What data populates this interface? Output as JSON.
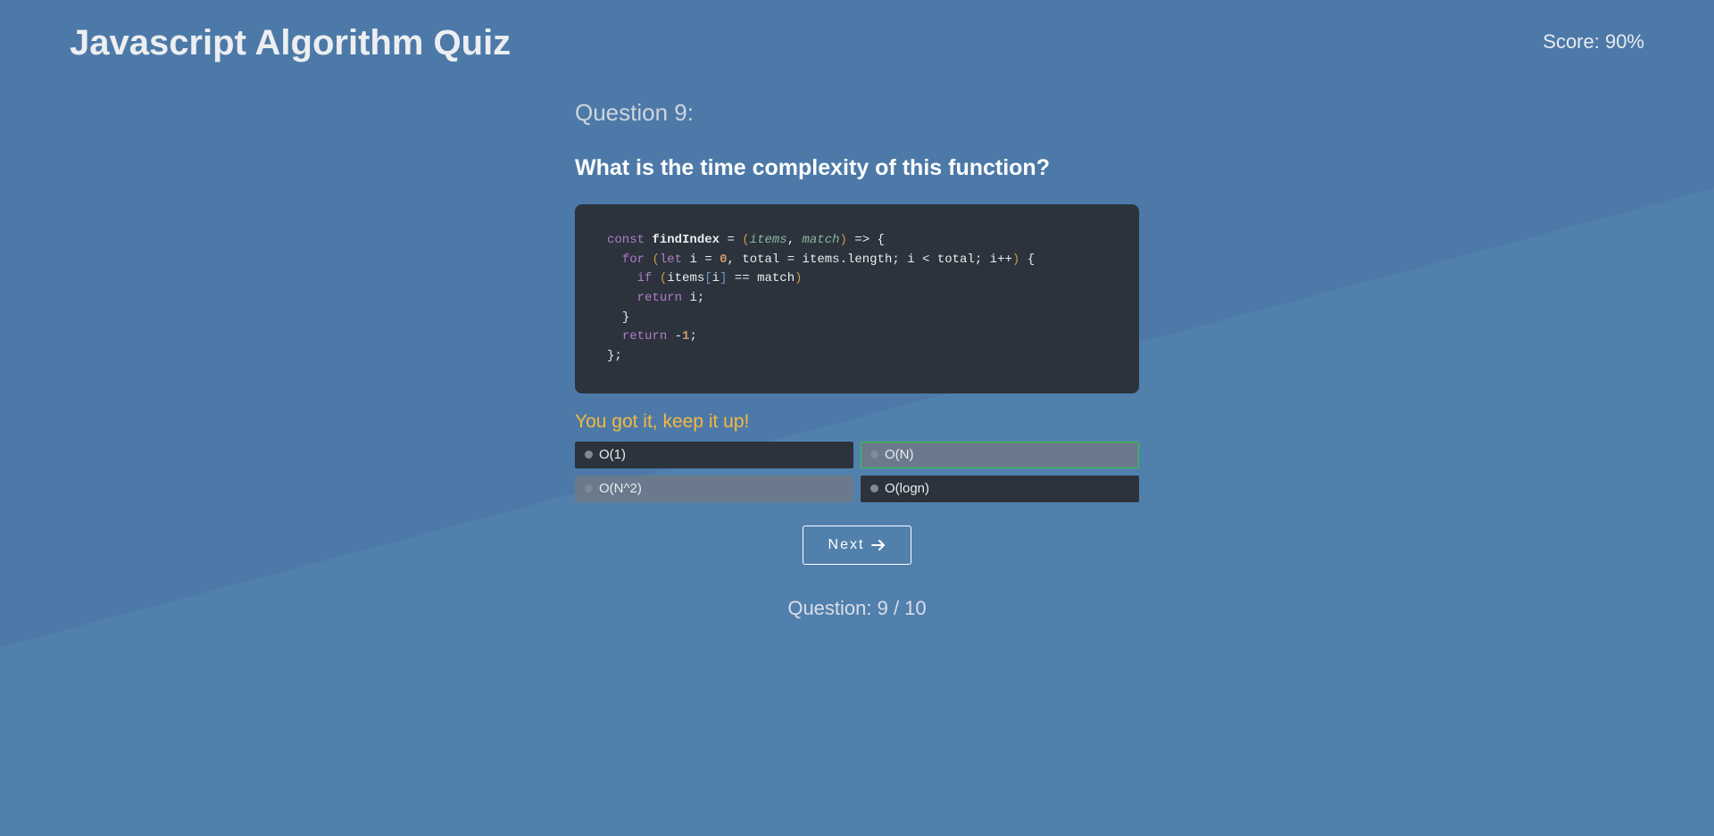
{
  "header": {
    "title": "Javascript Algorithm Quiz",
    "score_label": "Score: 90%"
  },
  "question": {
    "label": "Question 9:",
    "prompt": "What is the time complexity of this function?",
    "code_tokens": [
      [
        "kw",
        "const"
      ],
      [
        "sp",
        " "
      ],
      [
        "fn",
        "findIndex"
      ],
      [
        "sp",
        " "
      ],
      [
        "op",
        "="
      ],
      [
        "sp",
        " "
      ],
      [
        "paren",
        "("
      ],
      [
        "param",
        "items"
      ],
      [
        "pn",
        ", "
      ],
      [
        "param",
        "match"
      ],
      [
        "paren",
        ")"
      ],
      [
        "sp",
        " "
      ],
      [
        "op",
        "=>"
      ],
      [
        "sp",
        " "
      ],
      [
        "pn",
        "{"
      ],
      [
        "nl"
      ],
      [
        "sp",
        "  "
      ],
      [
        "kw",
        "for"
      ],
      [
        "sp",
        " "
      ],
      [
        "paren",
        "("
      ],
      [
        "kw",
        "let"
      ],
      [
        "sp",
        " "
      ],
      [
        "ident",
        "i"
      ],
      [
        "sp",
        " "
      ],
      [
        "op",
        "="
      ],
      [
        "sp",
        " "
      ],
      [
        "num",
        "0"
      ],
      [
        "pn",
        ", "
      ],
      [
        "ident",
        "total"
      ],
      [
        "sp",
        " "
      ],
      [
        "op",
        "="
      ],
      [
        "sp",
        " "
      ],
      [
        "ident",
        "items"
      ],
      [
        "pn",
        "."
      ],
      [
        "ident",
        "length"
      ],
      [
        "pn",
        "; "
      ],
      [
        "ident",
        "i"
      ],
      [
        "sp",
        " "
      ],
      [
        "op",
        "<"
      ],
      [
        "sp",
        " "
      ],
      [
        "ident",
        "total"
      ],
      [
        "pn",
        "; "
      ],
      [
        "ident",
        "i"
      ],
      [
        "op",
        "++"
      ],
      [
        "paren",
        ")"
      ],
      [
        "sp",
        " "
      ],
      [
        "pn",
        "{"
      ],
      [
        "nl"
      ],
      [
        "sp",
        "    "
      ],
      [
        "kw",
        "if"
      ],
      [
        "sp",
        " "
      ],
      [
        "paren",
        "("
      ],
      [
        "ident",
        "items"
      ],
      [
        "bracket",
        "["
      ],
      [
        "ident",
        "i"
      ],
      [
        "bracket",
        "]"
      ],
      [
        "sp",
        " "
      ],
      [
        "op",
        "=="
      ],
      [
        "sp",
        " "
      ],
      [
        "ident",
        "match"
      ],
      [
        "paren",
        ")"
      ],
      [
        "nl"
      ],
      [
        "sp",
        "    "
      ],
      [
        "kw",
        "return"
      ],
      [
        "sp",
        " "
      ],
      [
        "ident",
        "i"
      ],
      [
        "pn",
        ";"
      ],
      [
        "nl"
      ],
      [
        "sp",
        "  "
      ],
      [
        "pn",
        "}"
      ],
      [
        "nl"
      ],
      [
        "sp",
        "  "
      ],
      [
        "kw",
        "return"
      ],
      [
        "sp",
        " "
      ],
      [
        "op",
        "-"
      ],
      [
        "num",
        "1"
      ],
      [
        "pn",
        ";"
      ],
      [
        "nl"
      ],
      [
        "pn",
        "}"
      ],
      [
        "pn",
        ";"
      ]
    ]
  },
  "feedback": "You got it, keep it up!",
  "options": [
    {
      "label": "O(1)",
      "state": "default"
    },
    {
      "label": "O(N)",
      "state": "correct"
    },
    {
      "label": "O(N^2)",
      "state": "hover"
    },
    {
      "label": "O(logn)",
      "state": "default"
    }
  ],
  "next_button_label": "Next",
  "progress": "Question: 9 / 10"
}
